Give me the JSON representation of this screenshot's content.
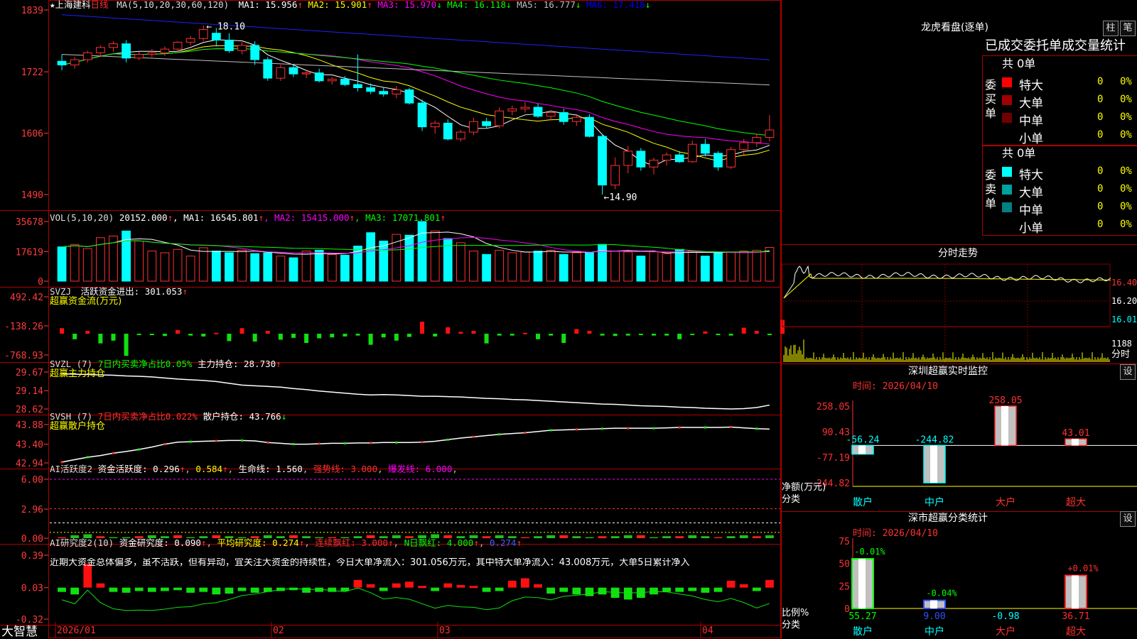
{
  "stock": {
    "name": "上海建科",
    "period": "日线",
    "star": "★"
  },
  "brand": "大智慧",
  "price_panel": {
    "ma_label": "MA(5,10,20,30,60,120)",
    "ma": [
      {
        "label": "MA1:",
        "value": "15.956",
        "dir": "↑",
        "color": "#ffffff"
      },
      {
        "label": "MA2:",
        "value": "15.901",
        "dir": "↑",
        "color": "#ffff00"
      },
      {
        "label": "MA3:",
        "value": "15.970",
        "dir": "↓",
        "color": "#ff00ff"
      },
      {
        "label": "MA4:",
        "value": "16.118",
        "dir": "↓",
        "color": "#00ff00"
      },
      {
        "label": "MA5:",
        "value": "16.777",
        "dir": "↓",
        "color": "#c0c0c0"
      },
      {
        "label": "MA6:",
        "value": "17.418",
        "dir": "↓",
        "color": "#0000ff"
      }
    ],
    "yticks": [
      "1839",
      "1722",
      "1606",
      "1490"
    ],
    "high_note": "18.10",
    "low_note": "←14.90"
  },
  "vol_panel": {
    "label": "VOL(5,10,20)",
    "value": "20152.000",
    "dir": "↑",
    "ma": [
      {
        "label": "MA1:",
        "value": "16545.801",
        "dir": "↑",
        "color": "#ffffff"
      },
      {
        "label": "MA2:",
        "value": "15415.000",
        "dir": "↑",
        "color": "#ff00ff"
      },
      {
        "label": "MA3:",
        "value": "17071.801",
        "dir": "↑",
        "color": "#00ff00"
      }
    ],
    "yticks": [
      "35678",
      "17619",
      "0"
    ]
  },
  "svzj_panel": {
    "name": "SVZJ",
    "label": "活跃资金进出:",
    "value": "301.053",
    "dir": "↑",
    "sub": "超赢资金流(万元)",
    "yticks": [
      "492.42",
      "-138.26",
      "-768.93"
    ]
  },
  "svzl_panel": {
    "name": "SVZL (7)",
    "label": "7日内买卖净占比0.05%",
    "label2": "主力持仓:",
    "value": "28.730",
    "dir": "↑",
    "sub": "超赢主力持仓",
    "yticks": [
      "29.67",
      "29.14",
      "28.62"
    ]
  },
  "svsh_panel": {
    "name": "SVSH (7)",
    "label": "7日内买卖净占比0.022%",
    "label2": "散户持仓:",
    "value": "43.766",
    "dir": "↓",
    "sub": "超赢散户持仓",
    "yticks": [
      "43.88",
      "43.40",
      "42.94"
    ]
  },
  "ai1_panel": {
    "name": "AI活跃度2",
    "label": "资金活跃度:",
    "v1": "0.296",
    "v2": "0.584",
    "l3": "生命线:",
    "v3": "1.560",
    "l4": "强势线:",
    "v4": "3.000",
    "l5": "爆发线:",
    "v5": "6.000",
    "yticks": [
      "6.00",
      "2.96",
      "0.00"
    ]
  },
  "ai2_panel": {
    "name": "AI研究度2(10)",
    "label": "资金研究度:",
    "v1": "0.090",
    "l2": "平均研究度:",
    "v2": "0.274",
    "l3": "连续飘红:",
    "v3": "3.000",
    "l4": "N日飘红:",
    "v4": "4.000",
    "v5": "0.274",
    "note": "近期大资金总体偏多，虽不活跃，但有异动，宜关注大资金的持续性，今日大单净流入：301.056万元，其中特大单净流入：43.008万元，大单5日累计净入",
    "yticks": [
      "0.39",
      "0.03",
      "-0.32"
    ]
  },
  "x_axis": [
    "2026/01",
    "02",
    "03",
    "04"
  ],
  "lhb": {
    "title": "龙虎看盘(逐单)",
    "btn1": "柱",
    "btn2": "笔",
    "tabs": "已成交委托单成交量统计",
    "buy": {
      "side": "委买单",
      "total": "共 0单",
      "rows": [
        {
          "label": "特大",
          "count": "0",
          "pct": "0%",
          "color": "#ff0000"
        },
        {
          "label": "大单",
          "count": "0",
          "pct": "0%",
          "color": "#a00000"
        },
        {
          "label": "中单",
          "count": "0",
          "pct": "0%",
          "color": "#700000"
        },
        {
          "label": "小单",
          "count": "0",
          "pct": "0%",
          "color": "#000000"
        }
      ]
    },
    "sell": {
      "side": "委卖单",
      "total": "共 0单",
      "rows": [
        {
          "label": "特大",
          "count": "0",
          "pct": "0%",
          "color": "#00ffff"
        },
        {
          "label": "大单",
          "count": "0",
          "pct": "0%",
          "color": "#00a0a0"
        },
        {
          "label": "中单",
          "count": "0",
          "pct": "0%",
          "color": "#008080"
        },
        {
          "label": "小单",
          "count": "0",
          "pct": "0%",
          "color": "#000000"
        }
      ]
    }
  },
  "intraday": {
    "title": "分时走势",
    "yticks": [
      "16.40",
      "16.20",
      "16.01"
    ],
    "vol_label": "1188",
    "unit": "分时"
  },
  "monitor": {
    "title": "深圳超赢实时监控",
    "btn": "设",
    "time": "时间: 2026/04/10",
    "ylabel": "净额(万元)",
    "xlabel": "分类",
    "yticks": [
      "258.05",
      "90.43",
      "-77.19",
      "-244.82"
    ],
    "categories": [
      "散户",
      "中户",
      "大户",
      "超大"
    ],
    "values": [
      -56.24,
      -244.82,
      258.05,
      43.01
    ],
    "value_labels": [
      "-56.24",
      "-244.82",
      "258.05",
      "43.01"
    ]
  },
  "stats": {
    "title": "深市超赢分类统计",
    "btn": "设",
    "time": "时间: 2026/04/10",
    "ylabel": "比例%",
    "xlabel": "分类",
    "yticks": [
      "75",
      "50",
      "25",
      "0"
    ],
    "categories": [
      "散户",
      "中户",
      "大户",
      "超大"
    ],
    "values": [
      55.27,
      9.0,
      -0.98,
      36.71
    ],
    "value_labels": [
      "55.27",
      "9.00",
      "-0.98",
      "36.71"
    ],
    "change_labels": [
      "-0.01%",
      "-0.04%",
      "",
      "+0.01%"
    ]
  },
  "chart_data": {
    "type": "candlestick",
    "title": "上海建科 日线",
    "x": [
      "2026/01",
      "02",
      "03",
      "04"
    ],
    "ylim": [
      14.9,
      18.39
    ],
    "high": 18.1,
    "low": 14.9,
    "ohlc": [
      [
        17.42,
        17.55,
        17.25,
        17.35
      ],
      [
        17.35,
        17.5,
        17.28,
        17.45
      ],
      [
        17.45,
        17.62,
        17.4,
        17.58
      ],
      [
        17.58,
        17.72,
        17.5,
        17.68
      ],
      [
        17.68,
        17.8,
        17.6,
        17.75
      ],
      [
        17.75,
        17.82,
        17.4,
        17.48
      ],
      [
        17.48,
        17.6,
        17.44,
        17.55
      ],
      [
        17.55,
        17.65,
        17.5,
        17.58
      ],
      [
        17.58,
        17.7,
        17.52,
        17.65
      ],
      [
        17.65,
        17.8,
        17.6,
        17.78
      ],
      [
        17.78,
        17.9,
        17.72,
        17.85
      ],
      [
        17.85,
        18.1,
        17.8,
        18.02
      ],
      [
        17.95,
        18.05,
        17.7,
        17.82
      ],
      [
        17.82,
        17.95,
        17.58,
        17.62
      ],
      [
        17.62,
        17.78,
        17.55,
        17.72
      ],
      [
        17.72,
        17.8,
        17.35,
        17.45
      ],
      [
        17.45,
        17.5,
        17.05,
        17.1
      ],
      [
        17.1,
        17.35,
        17.05,
        17.3
      ],
      [
        17.3,
        17.35,
        17.12,
        17.18
      ],
      [
        17.18,
        17.25,
        17.1,
        17.2
      ],
      [
        17.2,
        17.28,
        17.02,
        17.05
      ],
      [
        17.05,
        17.12,
        16.98,
        17.08
      ],
      [
        17.08,
        17.14,
        16.95,
        16.98
      ],
      [
        16.98,
        17.55,
        16.85,
        16.92
      ],
      [
        16.92,
        17.0,
        16.8,
        16.85
      ],
      [
        16.85,
        16.92,
        16.75,
        16.8
      ],
      [
        16.8,
        16.95,
        16.72,
        16.88
      ],
      [
        16.88,
        16.92,
        16.6,
        16.63
      ],
      [
        16.63,
        16.7,
        16.1,
        16.18
      ],
      [
        16.18,
        16.3,
        16.05,
        16.25
      ],
      [
        16.25,
        16.32,
        15.92,
        15.95
      ],
      [
        15.95,
        16.12,
        15.9,
        16.08
      ],
      [
        16.08,
        16.35,
        16.02,
        16.28
      ],
      [
        16.28,
        16.35,
        16.15,
        16.2
      ],
      [
        16.2,
        16.55,
        16.15,
        16.48
      ],
      [
        16.48,
        16.58,
        16.4,
        16.52
      ],
      [
        16.52,
        16.65,
        16.45,
        16.55
      ],
      [
        16.55,
        16.62,
        16.35,
        16.38
      ],
      [
        16.38,
        16.5,
        16.3,
        16.45
      ],
      [
        16.45,
        16.52,
        16.22,
        16.28
      ],
      [
        16.28,
        16.4,
        16.2,
        16.36
      ],
      [
        16.36,
        16.42,
        15.98,
        16.0
      ],
      [
        16.0,
        16.05,
        14.9,
        15.08
      ],
      [
        15.08,
        15.6,
        15.0,
        15.45
      ],
      [
        15.45,
        15.82,
        15.3,
        15.72
      ],
      [
        15.72,
        15.78,
        15.35,
        15.42
      ],
      [
        15.42,
        15.6,
        15.28,
        15.55
      ],
      [
        15.55,
        15.7,
        15.45,
        15.65
      ],
      [
        15.65,
        15.72,
        15.5,
        15.52
      ],
      [
        15.52,
        15.92,
        15.5,
        15.85
      ],
      [
        15.85,
        15.95,
        15.62,
        15.68
      ],
      [
        15.68,
        15.72,
        15.35,
        15.42
      ],
      [
        15.42,
        15.8,
        15.38,
        15.75
      ],
      [
        15.75,
        15.95,
        15.65,
        15.88
      ],
      [
        15.88,
        16.05,
        15.8,
        15.98
      ],
      [
        15.98,
        16.4,
        15.9,
        16.12
      ]
    ],
    "volume": [
      20500,
      22000,
      19500,
      26000,
      27000,
      30000,
      24000,
      18000,
      17000,
      19000,
      15000,
      20000,
      18000,
      17000,
      18500,
      16500,
      17000,
      15000,
      14000,
      18000,
      18500,
      16000,
      15500,
      21000,
      29000,
      24000,
      28000,
      27500,
      35678,
      30000,
      25500,
      23000,
      18000,
      16000,
      18500,
      17000,
      17500,
      18000,
      18500,
      16000,
      17000,
      17000,
      22000,
      18000,
      17500,
      15000,
      17500,
      16500,
      19000,
      18000,
      15000,
      17000,
      17500,
      18000,
      18500,
      20152
    ],
    "svzj": [
      120,
      -120,
      60,
      -210,
      -150,
      -480,
      -30,
      -20,
      -50,
      80,
      -40,
      -60,
      20,
      -160,
      120,
      -170,
      60,
      -130,
      -90,
      -200,
      -100,
      -80,
      -60,
      -40,
      -240,
      -80,
      -150,
      -70,
      260,
      -60,
      140,
      40,
      60,
      -210,
      -40,
      -40,
      20,
      -120,
      -40,
      -200,
      100,
      60,
      -40,
      -50,
      -40,
      -20,
      -40,
      -40,
      -120,
      -30,
      50,
      -30,
      -40,
      130,
      60,
      -25,
      301
    ],
    "svzl": [
      29.62,
      29.61,
      29.6,
      29.59,
      29.58,
      29.56,
      29.55,
      29.53,
      29.5,
      29.47,
      29.45,
      29.43,
      29.4,
      29.35,
      29.3,
      29.28,
      29.26,
      29.24,
      29.2,
      29.17,
      29.13,
      29.1,
      29.07,
      29.04,
      29.02,
      29.03,
      29.02,
      29.0,
      28.98,
      28.98,
      28.97,
      28.96,
      28.94,
      28.92,
      28.91,
      28.89,
      28.88,
      28.86,
      28.84,
      28.82,
      28.8,
      28.78,
      28.76,
      28.75,
      28.73,
      28.71,
      28.7,
      28.69,
      28.67,
      28.66,
      28.64,
      28.63,
      28.62,
      28.63,
      28.66,
      28.73
    ],
    "svsh": [
      42.96,
      43.02,
      43.08,
      43.12,
      43.18,
      43.22,
      43.27,
      43.33,
      43.4,
      43.45,
      43.46,
      43.47,
      43.48,
      43.49,
      43.49,
      43.48,
      43.44,
      43.42,
      43.4,
      43.4,
      43.41,
      43.42,
      43.42,
      43.43,
      43.43,
      43.44,
      43.44,
      43.44,
      43.45,
      43.47,
      43.51,
      43.55,
      43.58,
      43.61,
      43.64,
      43.66,
      43.68,
      43.71,
      43.74,
      43.75,
      43.76,
      43.77,
      43.78,
      43.79,
      43.79,
      43.79,
      43.79,
      43.8,
      43.81,
      43.81,
      43.81,
      43.81,
      43.82,
      43.8,
      43.78,
      43.77
    ],
    "ai1": [
      0.1,
      0.3,
      0.4,
      0.2,
      0.1,
      0.1,
      0.2,
      0.3,
      0.2,
      0.3,
      0.1,
      0.2,
      0.3,
      0.2,
      0.1,
      0.2,
      0.3,
      0.2,
      0.3,
      0.2,
      0.1,
      0.1,
      0.1,
      0.2,
      0.3,
      0.2,
      0.3,
      0.2,
      0.3,
      0.4,
      0.3,
      0.2,
      0.3,
      0.2,
      0.3,
      0.2,
      0.1,
      0.2,
      0.3,
      0.3,
      0.2,
      0.1,
      0.2,
      0.2,
      0.3,
      0.3,
      0.1,
      0.2,
      0.2,
      0.3,
      0.2,
      0.1,
      0.2,
      0.3,
      0.2,
      0.296
    ],
    "ai2": [
      -0.05,
      -0.08,
      0.28,
      0.05,
      -0.05,
      -0.06,
      -0.04,
      -0.05,
      -0.04,
      -0.03,
      -0.06,
      -0.05,
      -0.08,
      -0.07,
      -0.04,
      -0.06,
      -0.05,
      -0.04,
      -0.03,
      -0.06,
      -0.05,
      -0.05,
      -0.04,
      0.09,
      0.04,
      -0.04,
      0.05,
      0.07,
      0.02,
      -0.04,
      0.05,
      0.03,
      0.02,
      -0.05,
      -0.04,
      0.08,
      0.11,
      0.04,
      -0.07,
      -0.05,
      -0.08,
      -0.1,
      -0.08,
      -0.12,
      -0.14,
      -0.12,
      -0.08,
      -0.05,
      -0.05,
      -0.04,
      -0.06,
      -0.05,
      0.08,
      0.04,
      -0.04,
      0.09
    ]
  }
}
